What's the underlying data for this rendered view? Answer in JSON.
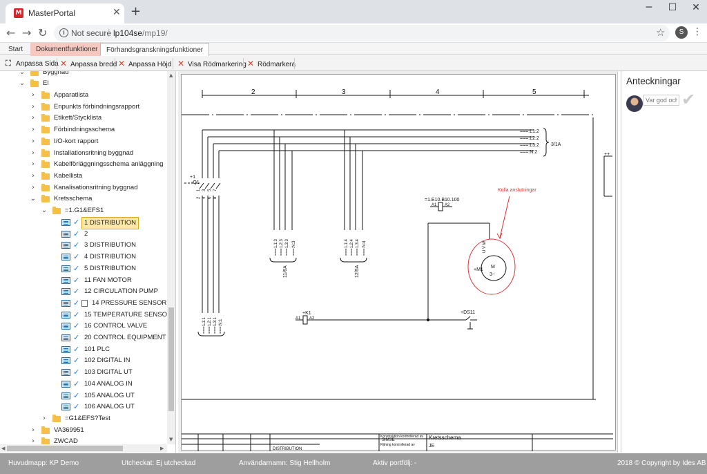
{
  "browser": {
    "tab_title": "MasterPortal",
    "tab_icon": "app-logo-icon",
    "not_secure": "Not secure",
    "url_host": "lp104se",
    "url_path": "/mp19/",
    "profile_initial": "S"
  },
  "ribbon": {
    "tabs": [
      "Start",
      "Dokumentfunktioner",
      "Förhandsgranskningsfunktioner"
    ]
  },
  "toolbar": {
    "fit_page": "Anpassa Sida",
    "fit_width": "Anpassa bredd",
    "fit_height": "Anpassa Höjd",
    "show_redline": "Visa Rödmarkering",
    "redline": "Rödmarkera"
  },
  "tree": {
    "top": [
      "Byggnad",
      "El"
    ],
    "el_children": [
      "Apparatlista",
      "Enpunkts förbindningsrapport",
      "Etikett/Stycklista",
      "Förbindningsschema",
      "I/O-kort rapport",
      "Installationsritning byggnad",
      "Kabelförläggningsschema anläggning",
      "Kabellista",
      "Kanalisationsritning byggnad",
      "Kretsschema"
    ],
    "kretsschema_child": "=1.G1&EFS1",
    "sheets": [
      "1 DISTRIBUTION",
      "2",
      "3 DISTRIBUTION",
      "4 DISTRIBUTION",
      "5 DISTRIBUTION",
      "11 FAN MOTOR",
      "12 CIRCULATION PUMP",
      "14 PRESSURE SENSOR",
      "15 TEMPERATURE SENSOR",
      "16 CONTROL VALVE",
      "20 CONTROL EQUIPMENT",
      "101 PLC",
      "102 DIGITAL IN",
      "103 DIGITAL UT",
      "104 ANALOG IN",
      "105 ANALOG UT",
      "106 ANALOG UT"
    ],
    "after": [
      "=G1&EFS?Test",
      "VA369951",
      "ZWCAD"
    ]
  },
  "drawing": {
    "columns": [
      "2",
      "3",
      "4",
      "5"
    ],
    "buses": [
      "===:L1:2",
      "===:L2:2",
      "===:L3:2",
      "===:N:2"
    ],
    "bus_ref": "3/1A",
    "q1_label": "+1",
    "q1_sub": "-Q1",
    "q1_terminals": [
      "1",
      "3",
      "5",
      "7"
    ],
    "q1_terminals_out": [
      "2",
      "4",
      "6",
      "8"
    ],
    "drop1_labels": [
      "===:L1:3",
      "===:L2:3",
      "===:L3:3",
      "===:N:3"
    ],
    "drop1_ref": "11/6A",
    "drop2_labels": [
      "===:L1:4",
      "===:L2:4",
      "===:L3:4",
      "===:N:4"
    ],
    "drop2_ref": "12/5A",
    "drop3_labels": [
      "===:L1:1",
      "===:L2:1",
      "===:L3:1",
      "===:N:1"
    ],
    "relay_label": "=1.E10.B10.100",
    "relay_a1": "A1",
    "relay_a2": "A2",
    "k1_label": "+K1",
    "k1_a1": "A1",
    "k1_a2": "A2",
    "ds_label": "+DS11",
    "motor_label": "+M1",
    "motor_letter": "M",
    "motor_phase": "3~",
    "motor_terms": "U V W",
    "redline_note": "Kolla anslutningar",
    "right_mark": "++",
    "title_block": {
      "designed": "Konstruktion kontrollerad av",
      "checked_name": "SIMSE",
      "approved": "Ritning kontrollerad av",
      "approved_initials": "JE",
      "sheet_title": "Kretsschema",
      "sheet_name": "DISTRIBUTION"
    }
  },
  "notes": {
    "title": "Anteckningar",
    "placeholder": "Var god och"
  },
  "status": {
    "root_folder": "Huvudmapp: KP Demo",
    "checked_out": "Utcheckat: Ej utcheckad",
    "username": "Användarnamn: Stig Hellholm",
    "active_portfolio": "Aktiv portfölj: -",
    "copyright": "2018 © Copyright by Ides AB"
  },
  "colors": {
    "redline": "#e03030",
    "selected_bg": "#fce8a6",
    "ribbon_active": "#f7c8bf",
    "statusbar": "#9e9e9e"
  }
}
